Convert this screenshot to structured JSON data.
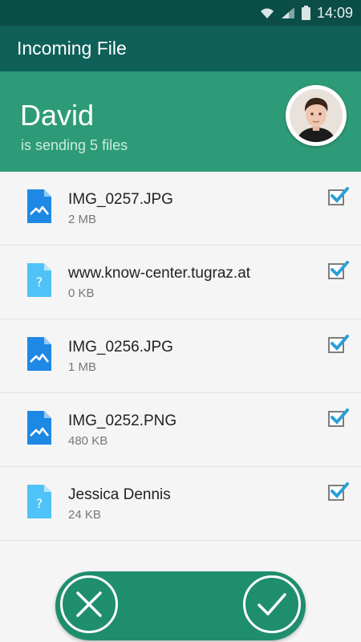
{
  "status_bar": {
    "time": "14:09",
    "icons": [
      "wifi-icon",
      "signal-icon",
      "battery-icon"
    ]
  },
  "app_bar": {
    "title": "Incoming File"
  },
  "sender": {
    "name": "David",
    "subtitle": "is sending 5 files"
  },
  "colors": {
    "status_bar": "#0b4d47",
    "app_bar": "#0f6058",
    "header": "#2e9b78",
    "action_bar": "#1f8e6d",
    "image_icon": "#1e88e5",
    "unknown_icon": "#4fc3f7",
    "check": "#2a9fd8"
  },
  "files": [
    {
      "name": "IMG_0257.JPG",
      "size": "2 MB",
      "icon": "image-file-icon",
      "checked": true
    },
    {
      "name": "www.know-center.tugraz.at",
      "size": "0 KB",
      "icon": "unknown-file-icon",
      "checked": true
    },
    {
      "name": "IMG_0256.JPG",
      "size": "1 MB",
      "icon": "image-file-icon",
      "checked": true
    },
    {
      "name": "IMG_0252.PNG",
      "size": "480 KB",
      "icon": "image-file-icon",
      "checked": true
    },
    {
      "name": "Jessica Dennis",
      "size": "24 KB",
      "icon": "unknown-file-icon",
      "checked": true
    }
  ],
  "actions": {
    "decline_icon": "close-icon",
    "accept_icon": "check-icon"
  }
}
